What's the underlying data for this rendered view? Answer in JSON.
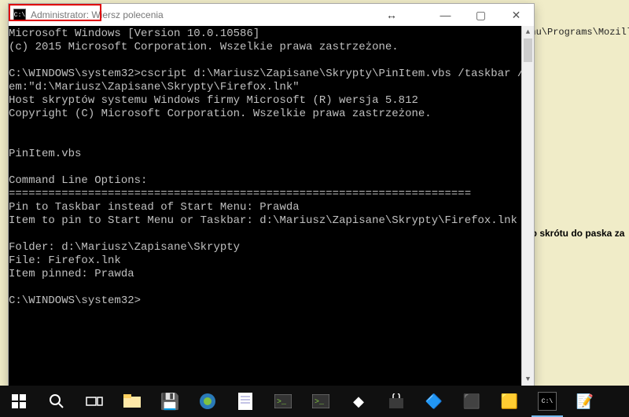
{
  "background": {
    "path_line": "Menu\\Programs\\Mozilla",
    "bold_text": "lub skrótu do paska za"
  },
  "window": {
    "title": "Administrator: Wiersz polecenia",
    "icon_text": "C:\\",
    "buttons": {
      "minimize": "—",
      "maximize": "▢",
      "close": "✕"
    },
    "resize_glyph": "↔"
  },
  "console": {
    "lines": [
      "Microsoft Windows [Version 10.0.10586]",
      "(c) 2015 Microsoft Corporation. Wszelkie prawa zastrzeżone.",
      "",
      "C:\\WINDOWS\\system32>cscript d:\\Mariusz\\Zapisane\\Skrypty\\PinItem.vbs /taskbar /it",
      "em:\"d:\\Mariusz\\Zapisane\\Skrypty\\Firefox.lnk\"",
      "Host skryptów systemu Windows firmy Microsoft (R) wersja 5.812",
      "Copyright (C) Microsoft Corporation. Wszelkie prawa zastrzeżone.",
      "",
      "",
      "PinItem.vbs",
      "",
      "Command Line Options:",
      "======================================================================",
      "Pin to Taskbar instead of Start Menu: Prawda",
      "Item to pin to Start Menu or Taskbar: d:\\Mariusz\\Zapisane\\Skrypty\\Firefox.lnk",
      "",
      "Folder: d:\\Mariusz\\Zapisane\\Skrypty",
      "File: Firefox.lnk",
      "Item pinned: Prawda",
      "",
      "C:\\WINDOWS\\system32>"
    ]
  },
  "taskbar": {
    "items": [
      {
        "name": "start",
        "glyph": "⊞"
      },
      {
        "name": "search",
        "glyph": "⌕"
      },
      {
        "name": "task-view",
        "glyph": "▭▭"
      },
      {
        "name": "file-explorer",
        "glyph": "📁"
      },
      {
        "name": "save",
        "glyph": "💾"
      },
      {
        "name": "browser",
        "glyph": "🌐"
      },
      {
        "name": "notepad",
        "glyph": "📄"
      },
      {
        "name": "terminal-1",
        "glyph": "▣"
      },
      {
        "name": "terminal-2",
        "glyph": "▣"
      },
      {
        "name": "app-1",
        "glyph": "◆"
      },
      {
        "name": "store",
        "glyph": "🛍"
      },
      {
        "name": "app-3",
        "glyph": "🔷"
      },
      {
        "name": "app-4",
        "glyph": "⬛"
      },
      {
        "name": "app-5",
        "glyph": "🟨"
      },
      {
        "name": "cmd",
        "glyph": "C:\\"
      },
      {
        "name": "notes",
        "glyph": "📝"
      }
    ]
  }
}
